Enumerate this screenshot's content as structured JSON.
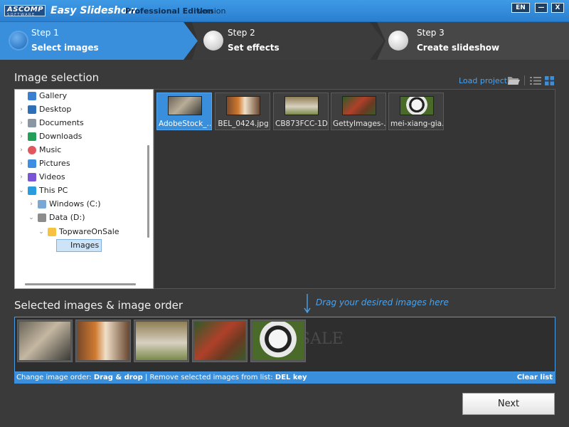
{
  "titlebar": {
    "logo_text": "ASCOMP",
    "logo_sub": "SOFTWARE",
    "app_name": "Easy Slideshow",
    "edition": "Professional Edition",
    "version_label": "Version",
    "lang": "EN",
    "minimize": "—",
    "close": "X"
  },
  "steps": [
    {
      "number": "Step 1",
      "name": "Select images",
      "active": true
    },
    {
      "number": "Step 2",
      "name": "Set effects",
      "active": false
    },
    {
      "number": "Step 3",
      "name": "Create slideshow",
      "active": false
    }
  ],
  "image_selection": {
    "title": "Image selection",
    "load_project": "Load project:",
    "view_mode": "grid"
  },
  "tree": {
    "items": [
      {
        "label": "Gallery",
        "icon": "gallery-icon",
        "color": "#3a7fd0",
        "expanded": false
      },
      {
        "label": "Desktop",
        "icon": "desktop-icon",
        "color": "#2f6fb8",
        "expanded": false
      },
      {
        "label": "Documents",
        "icon": "documents-icon",
        "color": "#8a96a3",
        "expanded": false
      },
      {
        "label": "Downloads",
        "icon": "downloads-icon",
        "color": "#22a05a",
        "expanded": false
      },
      {
        "label": "Music",
        "icon": "music-icon",
        "color": "#e0575e",
        "expanded": false
      },
      {
        "label": "Pictures",
        "icon": "pictures-icon",
        "color": "#3b8ee0",
        "expanded": false
      },
      {
        "label": "Videos",
        "icon": "videos-icon",
        "color": "#7a55d6",
        "expanded": false
      },
      {
        "label": "This PC",
        "icon": "computer-icon",
        "color": "#2b9be0",
        "expanded": true
      },
      {
        "label": "Windows (C:)",
        "icon": "drive-icon",
        "color": "#7aa7d4",
        "expanded": false
      },
      {
        "label": "Data (D:)",
        "icon": "drive-icon",
        "color": "#8c8c8c",
        "expanded": true
      },
      {
        "label": "TopwareOnSale",
        "icon": "folder-icon",
        "color": "#f5c242",
        "expanded": true
      },
      {
        "label": "Images",
        "icon": "folder-icon",
        "color": "#f5c242",
        "expanded": false,
        "selected": true
      }
    ]
  },
  "files": [
    {
      "caption": "AdobeStock_...",
      "selected": true,
      "subject": "lynx"
    },
    {
      "caption": "BEL_0424.jpg",
      "selected": false,
      "subject": "tiger"
    },
    {
      "caption": "CB873FCC-1D...",
      "selected": false,
      "subject": "rhino"
    },
    {
      "caption": "GettyImages-...",
      "selected": false,
      "subject": "red-panda"
    },
    {
      "caption": "mei-xiang-gia...",
      "selected": false,
      "subject": "panda"
    }
  ],
  "selected_section": {
    "title": "Selected images & image order",
    "drag_hint": "Drag your desired images here",
    "watermark": "SALE",
    "strip": [
      "lynx",
      "tiger",
      "rhino",
      "red-panda",
      "panda"
    ],
    "hint_prefix": "Change image order: ",
    "hint_drag": "Drag & drop",
    "hint_mid": " | Remove selected images from list: ",
    "hint_key": "DEL key",
    "clear_list": "Clear list"
  },
  "next_label": "Next",
  "colors": {
    "accent": "#3a8fdc",
    "link": "#4aa3ee",
    "background": "#3a3a3a"
  }
}
